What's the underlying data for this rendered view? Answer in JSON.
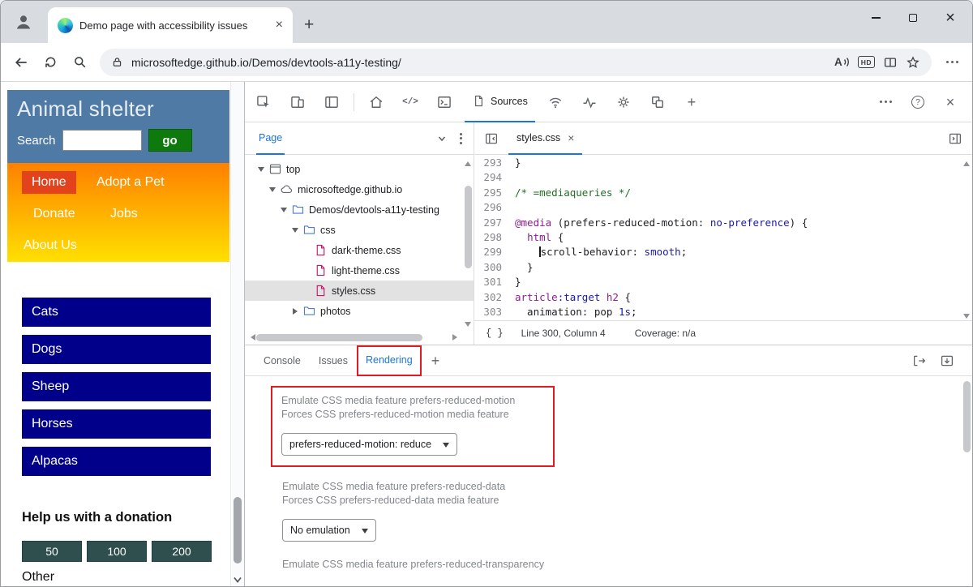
{
  "colors": {
    "accent": "#1a73e8",
    "annotation-red": "#e01b24",
    "navy": "#00008b",
    "header-blue": "#4e7aa5",
    "home-red": "#e2431c",
    "grad-top": "#ff8000",
    "grad-bottom": "#ffe000",
    "go-green": "#0e7a0e",
    "donate-slate": "#2f4f4f",
    "code-kw": "#8f1d8f",
    "code-sel": "#8f1d8f",
    "code-val": "#1a1aa6",
    "code-com": "#236e25"
  },
  "icons": {
    "plus": "+",
    "close": "×",
    "help": "?",
    "code": "</>",
    "braces": "{ }"
  },
  "browser": {
    "tab_title": "Demo page with accessibility issues",
    "url": "microsoftedge.github.io/Demos/devtools-a11y-testing/",
    "read_aloud_label": "A",
    "hd_label": "HD"
  },
  "page": {
    "title": "Animal shelter",
    "search_label": "Search",
    "search_value": "",
    "go_label": "go",
    "nav": [
      "Home",
      "Adopt a Pet",
      "Donate",
      "Jobs",
      "About Us"
    ],
    "categories": [
      "Cats",
      "Dogs",
      "Sheep",
      "Horses",
      "Alpacas"
    ],
    "donate_heading": "Help us with a donation",
    "amounts": [
      "50",
      "100",
      "200"
    ],
    "other_label": "Other"
  },
  "devtools": {
    "toolbar": {
      "sources_label": "Sources"
    },
    "navigator": {
      "pane_label": "Page",
      "tree": [
        {
          "label": "top",
          "icon": "frame",
          "depth": 0,
          "caret": "open"
        },
        {
          "label": "microsoftedge.github.io",
          "icon": "cloud",
          "depth": 1,
          "caret": "open"
        },
        {
          "label": "Demos/devtools-a11y-testing",
          "icon": "folder",
          "depth": 2,
          "caret": "open"
        },
        {
          "label": "css",
          "icon": "folder",
          "depth": 3,
          "caret": "open"
        },
        {
          "label": "dark-theme.css",
          "icon": "file",
          "depth": 4,
          "caret": "none"
        },
        {
          "label": "light-theme.css",
          "icon": "file",
          "depth": 4,
          "caret": "none"
        },
        {
          "label": "styles.css",
          "icon": "file",
          "depth": 4,
          "caret": "none",
          "selected": true
        },
        {
          "label": "photos",
          "icon": "folder",
          "depth": 3,
          "caret": "closed"
        }
      ]
    },
    "editor": {
      "file_tab": "styles.css",
      "status": {
        "position": "Line 300, Column 4",
        "coverage": "Coverage: n/a"
      },
      "lines": [
        {
          "n": "293",
          "tokens": [
            {
              "t": "}",
              "c": "p"
            }
          ]
        },
        {
          "n": "294",
          "tokens": []
        },
        {
          "n": "295",
          "tokens": [
            {
              "t": "/* =mediaqueries */",
              "c": "com"
            }
          ]
        },
        {
          "n": "296",
          "tokens": []
        },
        {
          "n": "297",
          "tokens": [
            {
              "t": "@media",
              "c": "kw"
            },
            {
              "t": " (prefers-reduced-motion: ",
              "c": "p"
            },
            {
              "t": "no-preference",
              "c": "val"
            },
            {
              "t": ") {",
              "c": "p"
            }
          ]
        },
        {
          "n": "298",
          "tokens": [
            {
              "t": "  ",
              "c": "p"
            },
            {
              "t": "html",
              "c": "sel"
            },
            {
              "t": " {",
              "c": "p"
            }
          ]
        },
        {
          "n": "299",
          "tokens": [
            {
              "t": "    ",
              "c": "p"
            },
            {
              "cursor": true
            },
            {
              "t": "scroll-behavior: ",
              "c": "p"
            },
            {
              "t": "smooth",
              "c": "val"
            },
            {
              "t": ";",
              "c": "p"
            }
          ]
        },
        {
          "n": "300",
          "tokens": [
            {
              "t": "  }",
              "c": "p"
            }
          ]
        },
        {
          "n": "301",
          "tokens": [
            {
              "t": "}",
              "c": "p"
            }
          ]
        },
        {
          "n": "302",
          "tokens": [
            {
              "t": "article",
              "c": "sel"
            },
            {
              "t": ":target",
              "c": "val"
            },
            {
              "t": " ",
              "c": "p"
            },
            {
              "t": "h2",
              "c": "sel"
            },
            {
              "t": " {",
              "c": "p"
            }
          ]
        },
        {
          "n": "303",
          "tokens": [
            {
              "t": "  animation: ",
              "c": "p"
            },
            {
              "t": "pop ",
              "c": "p"
            },
            {
              "t": "1s",
              "c": "val"
            },
            {
              "t": ";",
              "c": "p"
            }
          ]
        }
      ]
    },
    "drawer": {
      "tabs": [
        {
          "label": "Console"
        },
        {
          "label": "Issues"
        },
        {
          "label": "Rendering",
          "active": true
        }
      ],
      "sections": [
        {
          "line1": "Emulate CSS media feature prefers-reduced-motion",
          "line2": "Forces CSS prefers-reduced-motion media feature",
          "value": "prefers-reduced-motion: reduce",
          "control": "prefers-reduced-motion-select",
          "highlight": true
        },
        {
          "line1": "Emulate CSS media feature prefers-reduced-data",
          "line2": "Forces CSS prefers-reduced-data media feature",
          "value": "No emulation",
          "control": "prefers-reduced-data-select"
        },
        {
          "line1": "Emulate CSS media feature prefers-reduced-transparency"
        }
      ]
    }
  }
}
